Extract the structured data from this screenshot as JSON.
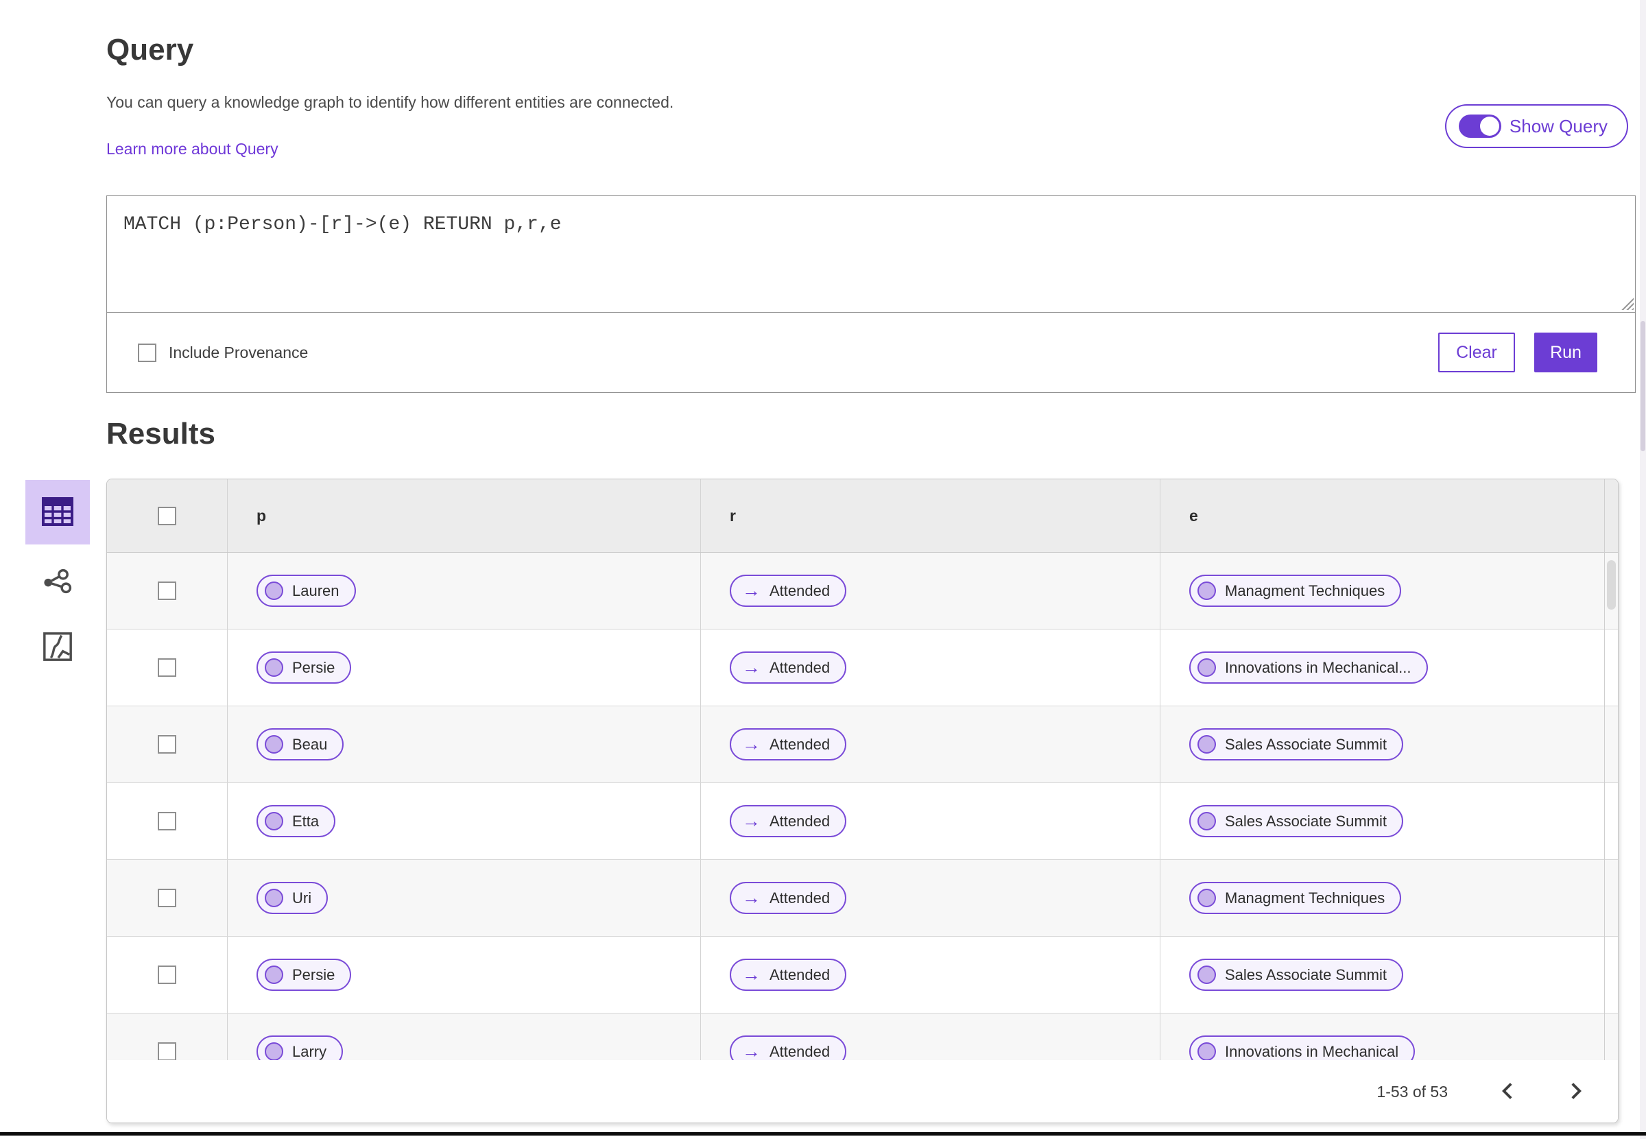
{
  "header": {
    "title": "Query",
    "description": "You can query a knowledge graph to identify how different entities are connected.",
    "learn_more_link": "Learn more about Query",
    "show_query_toggle": {
      "label": "Show Query",
      "on": true
    }
  },
  "query_panel": {
    "query_text": "MATCH (p:Person)-[r]->(e) RETURN p,r,e",
    "include_provenance_label": "Include Provenance",
    "include_provenance_checked": false,
    "clear_button": "Clear",
    "run_button": "Run"
  },
  "results": {
    "heading": "Results",
    "view_switcher": [
      {
        "name": "table-view",
        "selected": true
      },
      {
        "name": "graph-view",
        "selected": false
      },
      {
        "name": "schema-view",
        "selected": false
      }
    ],
    "table": {
      "columns": [
        "p",
        "r",
        "e"
      ],
      "relationship_arrow": "→",
      "rows": [
        {
          "p": "Lauren",
          "r": "Attended",
          "e": "Managment Techniques"
        },
        {
          "p": "Persie",
          "r": "Attended",
          "e": "Innovations in Mechanical..."
        },
        {
          "p": "Beau",
          "r": "Attended",
          "e": "Sales Associate Summit"
        },
        {
          "p": "Etta",
          "r": "Attended",
          "e": "Sales Associate Summit"
        },
        {
          "p": "Uri",
          "r": "Attended",
          "e": "Managment Techniques"
        },
        {
          "p": "Persie",
          "r": "Attended",
          "e": "Sales Associate Summit"
        },
        {
          "p": "Larry",
          "r": "Attended",
          "e": "Innovations in Mechanical"
        }
      ]
    },
    "pagination": {
      "range_label": "1-53 of 53"
    }
  },
  "colors": {
    "primary": "#6c3dd4",
    "link": "#6f38d8",
    "pill_border": "#7a4bd8",
    "pill_background": "#f6f3fd",
    "node_fill": "#c8b4ec",
    "selected_view_background": "#d8c8f6"
  }
}
